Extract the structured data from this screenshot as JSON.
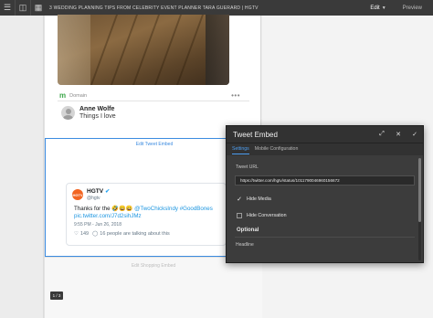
{
  "topbar": {
    "page_title": "3 WEDDING PLANNING TIPS FROM CELEBRITY EVENT PLANNER TARA GUERARD | HGTV",
    "mode_label": "Edit",
    "preview_label": "Preview"
  },
  "feed": {
    "domain_label": "Domain",
    "comment": {
      "author": "Anne Wolfe",
      "text": "Things I love"
    }
  },
  "embed": {
    "placeholder_label": "Edit Tweet Embed",
    "tweet": {
      "logo_text": "HGTV",
      "name": "HGTV",
      "handle": "@hgtv",
      "text_prefix": "Thanks for the 🤣😀😄 ",
      "text_links": "@TwoChicksIndy #GoodBones pic.twitter.com/J7d2sihJMz",
      "timestamp": "9:55 PM - Jun 26, 2018",
      "likes": "149",
      "talking": "16 people are talking about this"
    }
  },
  "shopping": {
    "placeholder_label": "Edit Shopping Embed",
    "pager": "1 / 3"
  },
  "dialog": {
    "title": "Tweet Embed",
    "tabs": [
      "Settings",
      "Mobile Configuration"
    ],
    "tweet_url_label": "Tweet URL",
    "tweet_url_value": "https://twitter.com/hgtv/status/1011790046960156672",
    "hide_media_label": "Hide Media",
    "hide_conversation_label": "Hide Conversation",
    "optional_label": "Optional",
    "headline_label": "Headline"
  },
  "colors": {
    "accent": "#3b8be0",
    "dialog_bg": "#323232",
    "domain_green": "#3da64a",
    "hgtv_orange": "#f26522"
  }
}
